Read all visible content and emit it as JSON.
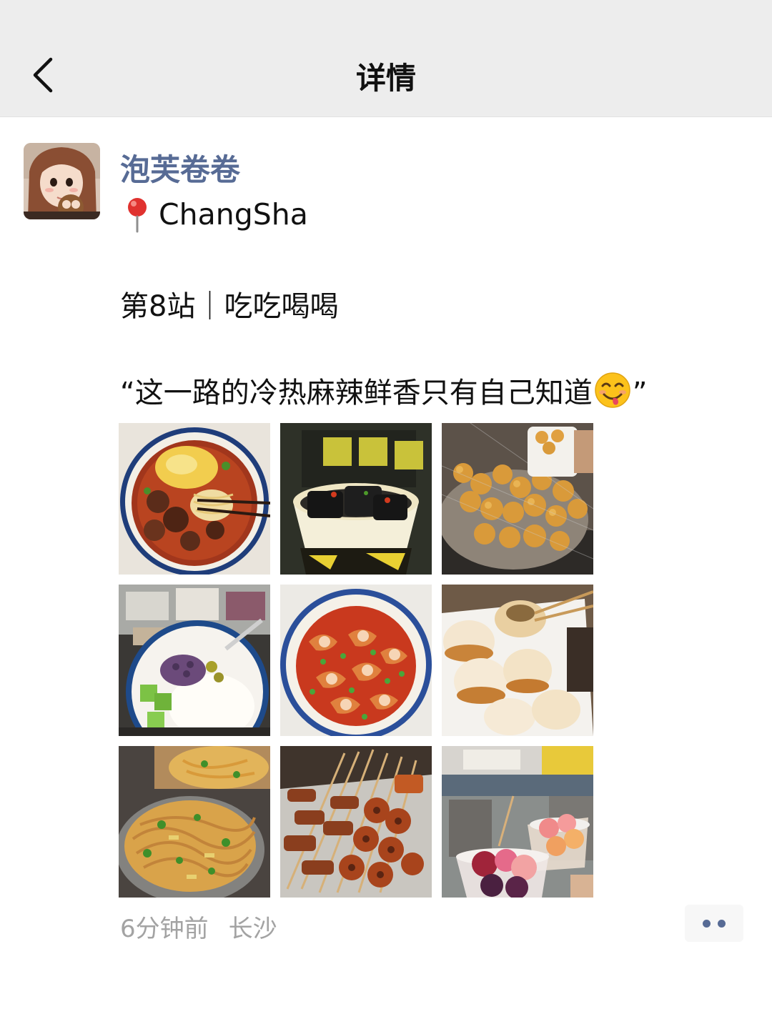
{
  "header": {
    "title": "详情",
    "back_icon": "chevron-left-icon"
  },
  "post": {
    "author": "泡芙卷卷",
    "location_pin_icon": "round-pushpin-icon",
    "location": "ChangSha",
    "line1": "第8站｜吃吃喝喝",
    "line2_text": "“这一路的冷热麻辣鲜香只有自己知道",
    "line2_emoji": "face-savoring-food-emoji",
    "line2_close": "”",
    "photos": [
      {
        "name": "beef-noodle-bowl-photo"
      },
      {
        "name": "stinky-tofu-cup-photo"
      },
      {
        "name": "fried-dough-balls-photo"
      },
      {
        "name": "dessert-bowl-photo"
      },
      {
        "name": "spicy-shrimp-plate-photo"
      },
      {
        "name": "pan-fried-buns-photo"
      },
      {
        "name": "cold-noodle-salad-photo"
      },
      {
        "name": "grilled-skewers-photo"
      },
      {
        "name": "fruit-cups-street-photo"
      }
    ],
    "time": "6分钟前",
    "city": "长沙",
    "more_icon": "more-dots-icon"
  },
  "colors": {
    "nav_bg": "#ededed",
    "author_name": "#576b95",
    "meta_gray": "#a3a3a3"
  }
}
